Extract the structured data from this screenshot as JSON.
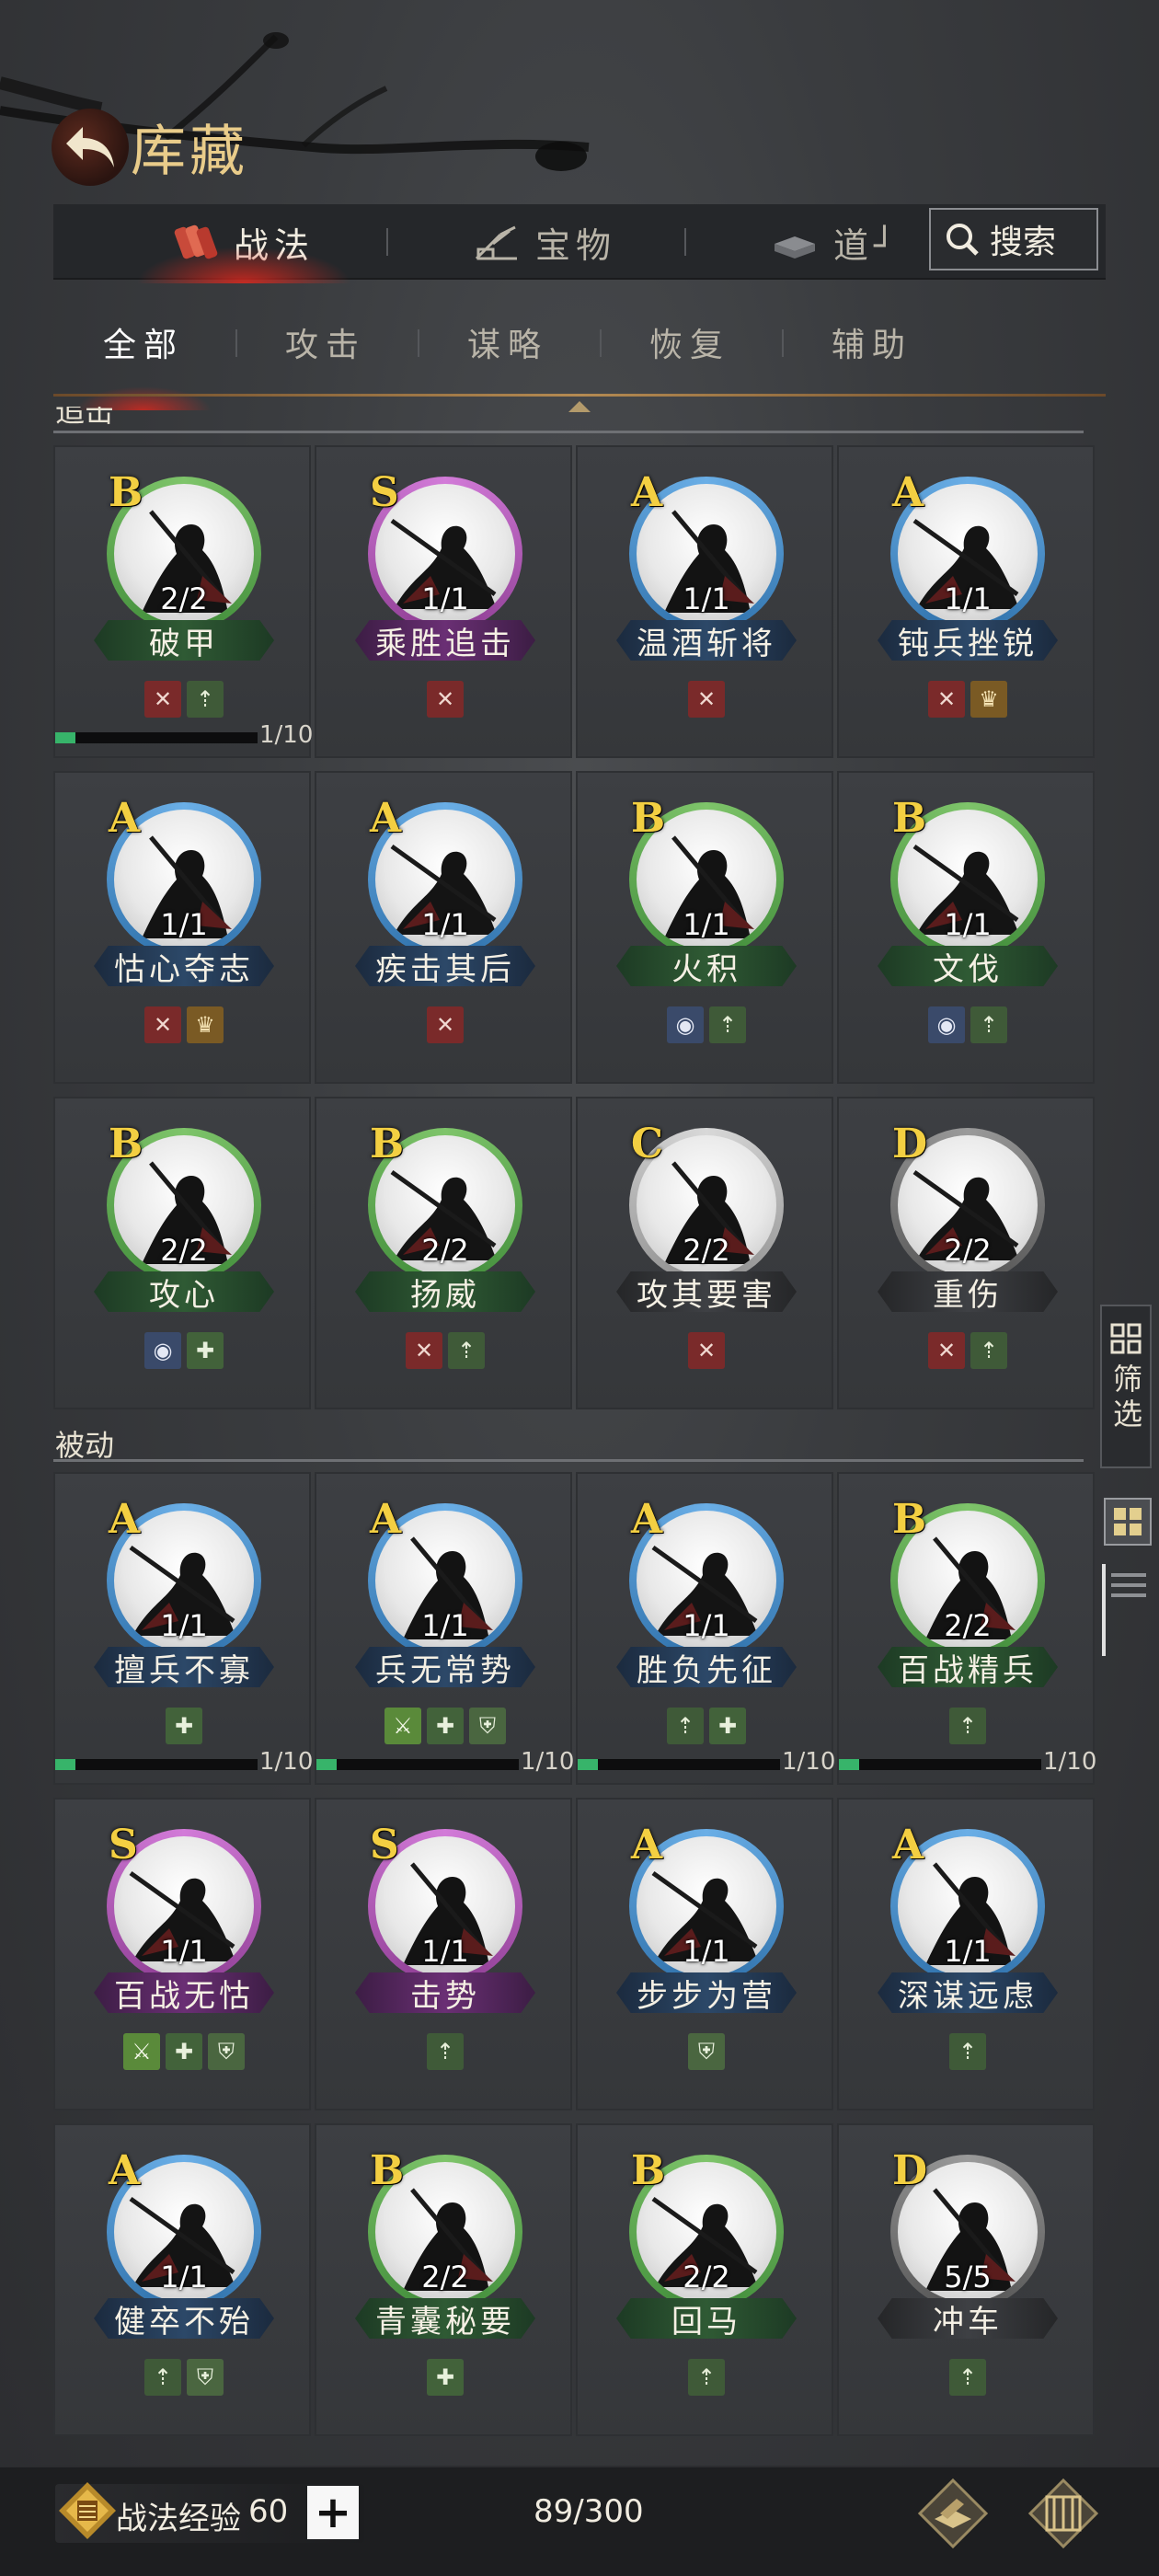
{
  "header": {
    "title": "库藏"
  },
  "top_tabs": [
    {
      "label": "战法",
      "icon": "scroll-bundle-icon",
      "active": true
    },
    {
      "label": "宝物",
      "icon": "crossbow-icon",
      "active": false
    },
    {
      "label": "道┘",
      "icon": "book-stack-icon",
      "active": false
    }
  ],
  "search": {
    "label": "搜索"
  },
  "sub_tabs": [
    {
      "label": "全部",
      "active": true
    },
    {
      "label": "攻击",
      "active": false
    },
    {
      "label": "谋略",
      "active": false
    },
    {
      "label": "恢复",
      "active": false
    },
    {
      "label": "辅助",
      "active": false
    }
  ],
  "sections": [
    {
      "label": "追击",
      "rows": [
        [
          {
            "grade": "B",
            "count": "2/2",
            "name": "破甲",
            "color": "green",
            "tags": [
              "attack",
              "up"
            ],
            "progress": "1/10",
            "progress_frac": 0.1
          },
          {
            "grade": "S",
            "count": "1/1",
            "name": "乘胜追击",
            "color": "purple",
            "tags": [
              "attack"
            ]
          },
          {
            "grade": "A",
            "count": "1/1",
            "name": "温酒斩将",
            "color": "blue",
            "tags": [
              "attack"
            ]
          },
          {
            "grade": "A",
            "count": "1/1",
            "name": "钝兵挫锐",
            "color": "blue",
            "tags": [
              "attack",
              "gold"
            ]
          }
        ],
        [
          {
            "grade": "A",
            "count": "1/1",
            "name": "怙心夺志",
            "color": "blue",
            "tags": [
              "attack",
              "gold"
            ]
          },
          {
            "grade": "A",
            "count": "1/1",
            "name": "疾击其后",
            "color": "blue",
            "tags": [
              "attack"
            ]
          },
          {
            "grade": "B",
            "count": "1/1",
            "name": "火积",
            "color": "green",
            "tags": [
              "blue",
              "up"
            ]
          },
          {
            "grade": "B",
            "count": "1/1",
            "name": "文伐",
            "color": "green",
            "tags": [
              "blue",
              "up"
            ]
          }
        ],
        [
          {
            "grade": "B",
            "count": "2/2",
            "name": "攻心",
            "color": "green",
            "tags": [
              "blue",
              "heal"
            ]
          },
          {
            "grade": "B",
            "count": "2/2",
            "name": "扬威",
            "color": "green",
            "tags": [
              "attack",
              "up"
            ]
          },
          {
            "grade": "C",
            "count": "2/2",
            "name": "攻其要害",
            "color": "gray",
            "tags": [
              "attack"
            ]
          },
          {
            "grade": "D",
            "count": "2/2",
            "name": "重伤",
            "color": "gray",
            "tags": [
              "attack",
              "up"
            ]
          }
        ]
      ]
    },
    {
      "label": "被动",
      "rows": [
        [
          {
            "grade": "A",
            "count": "1/1",
            "name": "擅兵不寡",
            "color": "blue",
            "tags": [
              "heal"
            ],
            "progress": "1/10",
            "progress_frac": 0.1
          },
          {
            "grade": "A",
            "count": "1/1",
            "name": "兵无常势",
            "color": "blue",
            "tags": [
              "bright",
              "heal",
              "shield"
            ],
            "progress": "1/10",
            "progress_frac": 0.1
          },
          {
            "grade": "A",
            "count": "1/1",
            "name": "胜负先征",
            "color": "blue",
            "tags": [
              "up",
              "heal"
            ],
            "progress": "1/10",
            "progress_frac": 0.1
          },
          {
            "grade": "B",
            "count": "2/2",
            "name": "百战精兵",
            "color": "green",
            "tags": [
              "up"
            ],
            "progress": "1/10",
            "progress_frac": 0.1
          }
        ],
        [
          {
            "grade": "S",
            "count": "1/1",
            "name": "百战无怙",
            "color": "purple",
            "tags": [
              "bright",
              "heal",
              "shield"
            ]
          },
          {
            "grade": "S",
            "count": "1/1",
            "name": "击势",
            "color": "purple",
            "tags": [
              "up"
            ]
          },
          {
            "grade": "A",
            "count": "1/1",
            "name": "步步为营",
            "color": "blue",
            "tags": [
              "shield"
            ]
          },
          {
            "grade": "A",
            "count": "1/1",
            "name": "深谋远虑",
            "color": "blue",
            "tags": [
              "up"
            ]
          }
        ],
        [
          {
            "grade": "A",
            "count": "1/1",
            "name": "健卒不殆",
            "color": "blue",
            "tags": [
              "up",
              "shield"
            ]
          },
          {
            "grade": "B",
            "count": "2/2",
            "name": "青囊秘要",
            "color": "green",
            "tags": [
              "heal"
            ]
          },
          {
            "grade": "B",
            "count": "2/2",
            "name": "回马",
            "color": "green",
            "tags": [
              "up"
            ]
          },
          {
            "grade": "D",
            "count": "5/5",
            "name": "冲车",
            "color": "gray",
            "tags": [
              "up"
            ]
          }
        ]
      ]
    }
  ],
  "side": {
    "filter_label": "筛选"
  },
  "bottom": {
    "exp_label": "战法经验",
    "exp_value": "60",
    "plus": "+",
    "capacity": "89/300"
  },
  "colors": {
    "accent_red": "#dc281e",
    "gold": "#e9cc8a",
    "grade_yellow": "#f3cf42"
  },
  "tag_glyphs": {
    "attack": "✕",
    "up": "⇡",
    "gold": "♛",
    "blue": "◉",
    "heal": "✚",
    "shield": "⛨",
    "bright": "⚔"
  }
}
